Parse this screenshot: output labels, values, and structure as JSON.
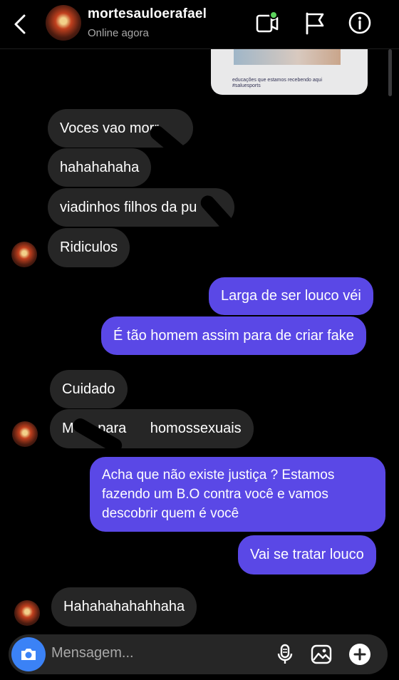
{
  "header": {
    "username": "mortesauloerafael",
    "status": "Online agora"
  },
  "shared_post": {
    "caption": "educações que estamos recebendo aqui #saluesports"
  },
  "messages": [
    {
      "text": "Voces vao morr",
      "sender": "them"
    },
    {
      "text": "hahahahaha",
      "sender": "them"
    },
    {
      "text": "viadinhos filhos da pu",
      "sender": "them"
    },
    {
      "text": "Ridiculos",
      "sender": "them"
    },
    {
      "text": "Larga de ser louco véi",
      "sender": "me"
    },
    {
      "text": "É tão homem assim para de criar fake",
      "sender": "me"
    },
    {
      "text": "Cuidado",
      "sender": "them"
    },
    {
      "text": "M para homossexuais",
      "sender": "them"
    },
    {
      "text": "Acha que não existe justiça ?  Estamos fazendo um B.O contra você e vamos descobrir quem é você",
      "sender": "me"
    },
    {
      "text": "Vai se tratar louco",
      "sender": "me"
    },
    {
      "text": "Hahahahahahhaha",
      "sender": "them"
    }
  ],
  "composer": {
    "placeholder": "Mensagem..."
  },
  "colors": {
    "outgoing_bubble": "#5a48e6",
    "incoming_bubble": "#262626",
    "camera_button": "#3b82f6",
    "online_dot": "#5cd35c"
  },
  "icons": [
    "back-icon",
    "video-call-icon",
    "flag-icon",
    "info-icon",
    "camera-icon",
    "microphone-icon",
    "gallery-icon",
    "plus-icon"
  ]
}
